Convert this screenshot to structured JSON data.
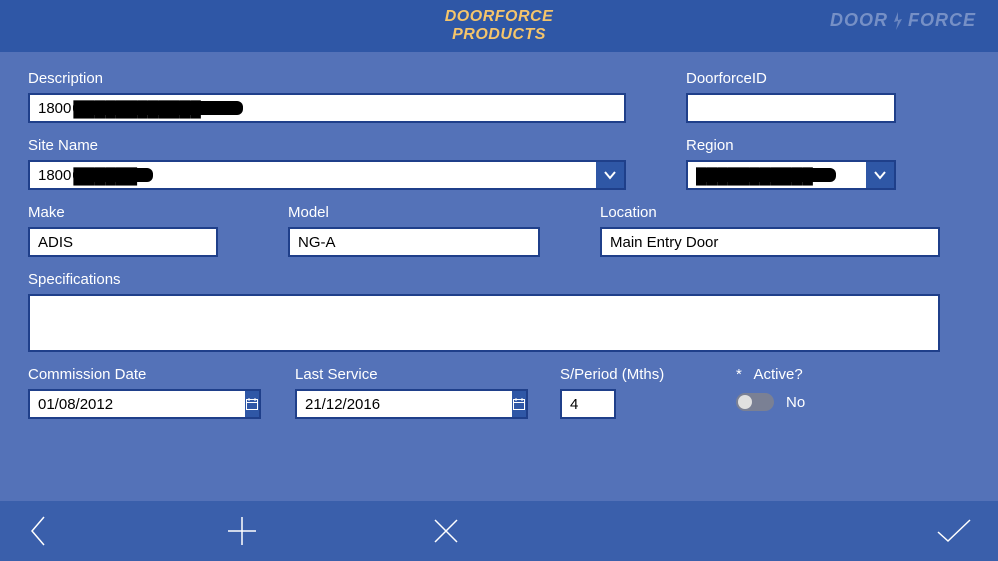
{
  "header": {
    "title_line1": "DOORFORCE",
    "title_line2": "PRODUCTS",
    "logo_part1": "DOOR",
    "logo_part2": "FORCE"
  },
  "labels": {
    "description": "Description",
    "doorforce_id": "DoorforceID",
    "site_name": "Site Name",
    "region": "Region",
    "make": "Make",
    "model": "Model",
    "location": "Location",
    "specifications": "Specifications",
    "commission_date": "Commission Date",
    "last_service": "Last Service",
    "s_period": "S/Period (Mths)",
    "active": "*   Active?"
  },
  "values": {
    "description_prefix": "1800",
    "description_redacted": "████████████",
    "doorforce_id": "",
    "site_name_prefix": "1800",
    "site_name_redacted": "██████",
    "region_redacted": "███████████",
    "make": "ADIS",
    "model": "NG-A",
    "location": "Main Entry Door",
    "specifications": "",
    "commission_date": "01/08/2012",
    "last_service": "21/12/2016",
    "s_period": "4",
    "active_state": "No"
  }
}
